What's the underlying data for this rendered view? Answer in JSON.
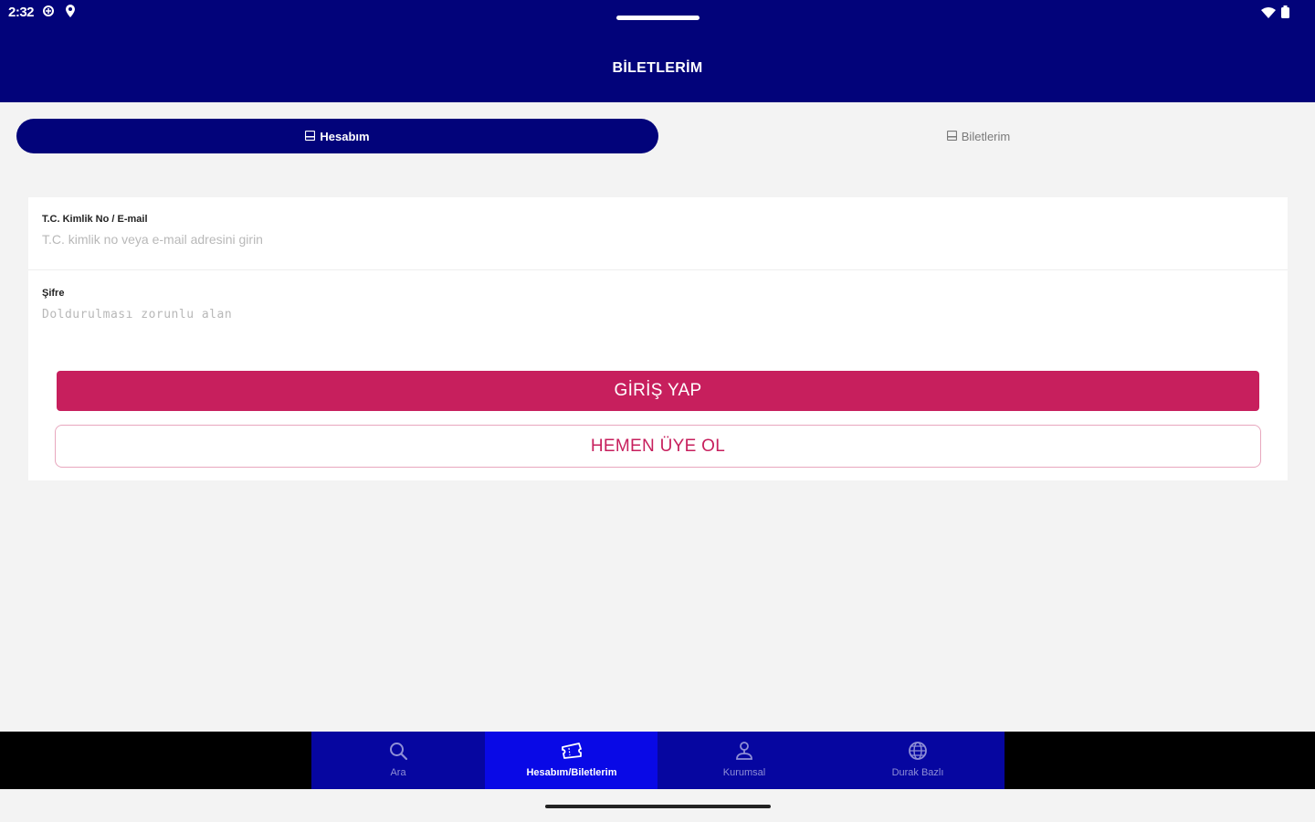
{
  "status": {
    "time": "2:32"
  },
  "header": {
    "title": "BİLETLERİM"
  },
  "segments": {
    "account": "Hesabım",
    "tickets": "Biletlerim"
  },
  "form": {
    "id_label": "T.C. Kimlik No / E-mail",
    "id_placeholder": "T.C. kimlik no veya e-mail adresini girin",
    "password_label": "Şifre",
    "password_placeholder": "Doldurulması zorunlu alan"
  },
  "buttons": {
    "login": "GİRİŞ YAP",
    "register": "HEMEN ÜYE OL"
  },
  "bottom_nav": [
    {
      "label": "Ara",
      "icon": "search-icon",
      "active": false
    },
    {
      "label": "Hesabım/Biletlerim",
      "icon": "ticket-icon",
      "active": true
    },
    {
      "label": "Kurumsal",
      "icon": "user-icon",
      "active": false
    },
    {
      "label": "Durak Bazlı",
      "icon": "globe-icon",
      "active": false
    }
  ],
  "colors": {
    "brand": "#02037a",
    "accent": "#c71f5d",
    "nav_active": "#0909e6"
  }
}
